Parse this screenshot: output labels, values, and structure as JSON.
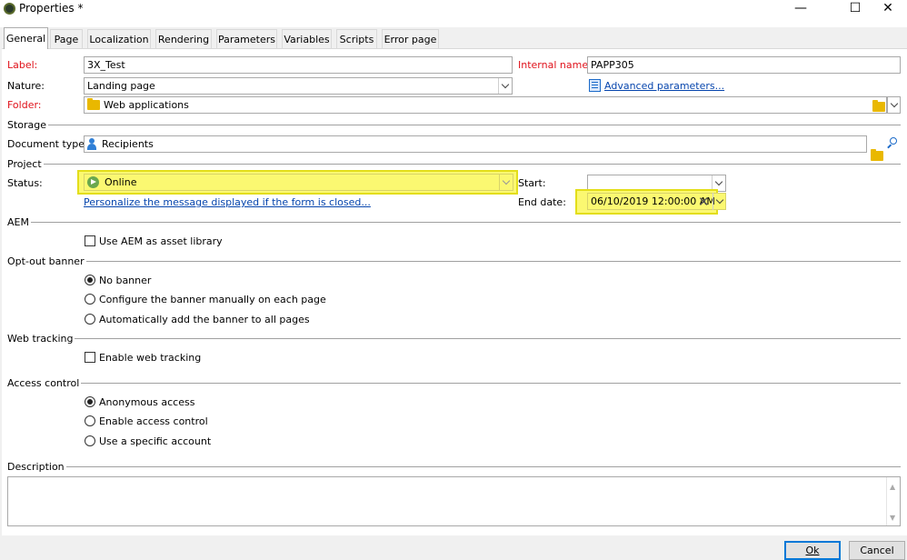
{
  "window": {
    "title": "Properties *",
    "minimize": "—",
    "maximize": "☐",
    "close": "✕"
  },
  "tabs": [
    "General",
    "Page",
    "Localization",
    "Rendering",
    "Parameters",
    "Variables",
    "Scripts",
    "Error page"
  ],
  "general": {
    "label_label": "Label:",
    "label_value": "3X_Test",
    "internal_name_label": "Internal name:",
    "internal_name_value": "PAPP305",
    "nature_label": "Nature:",
    "nature_value": "Landing page",
    "advanced_link": "Advanced parameters...",
    "folder_label": "Folder:",
    "folder_value": "Web applications"
  },
  "storage": {
    "title": "Storage",
    "doc_type_label": "Document type:",
    "doc_type_value": "Recipients"
  },
  "project": {
    "title": "Project",
    "status_label": "Status:",
    "status_value": "Online",
    "personalize_link": "Personalize the message displayed if the form is closed...",
    "start_label": "Start:",
    "start_value": "",
    "end_label": "End date:",
    "end_value": "06/10/2019 12:00:00 AM"
  },
  "aem": {
    "title": "AEM",
    "checkbox": "Use AEM as asset library",
    "checked": false
  },
  "optout": {
    "title": "Opt-out banner",
    "options": [
      "No banner",
      "Configure the banner manually on each page",
      "Automatically add the banner to all pages"
    ],
    "selected": 0
  },
  "webtracking": {
    "title": "Web tracking",
    "checkbox": "Enable web tracking",
    "checked": false
  },
  "access": {
    "title": "Access control",
    "options": [
      "Anonymous access",
      "Enable access control",
      "Use a specific account"
    ],
    "selected": 0
  },
  "description": {
    "title": "Description",
    "value": ""
  },
  "buttons": {
    "ok": "Ok",
    "cancel": "Cancel"
  },
  "colors": {
    "required_label": "#e0121b",
    "highlight": "#fbf871",
    "link": "#0645ad",
    "status_green": "#6aa84f"
  }
}
